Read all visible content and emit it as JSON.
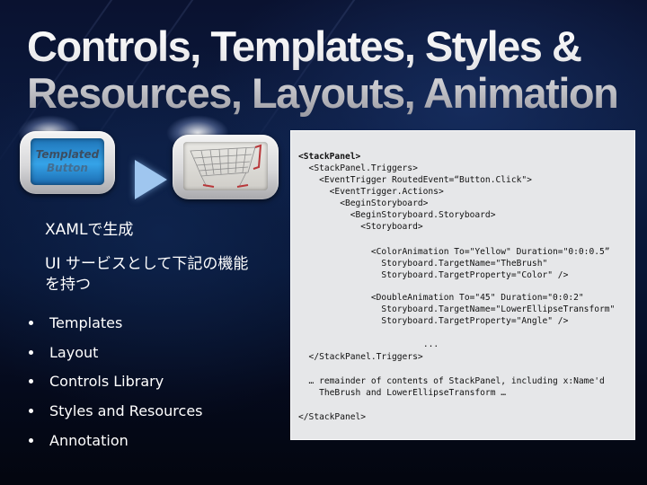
{
  "slide": {
    "title_lines": [
      "Controls, Templates, Styles &",
      "Resources, Layouts, Animation"
    ],
    "templated_button": {
      "line1": "Templated",
      "line2": "Button"
    },
    "cart_button_icon": "shopping-cart-icon",
    "arrow_icon": "play-triangle-icon",
    "xaml_label": "XAMLで生成",
    "ui_services_text_line1": "UI サービスとして下記の機能",
    "ui_services_text_line2": "を持つ",
    "bullets": [
      "Templates",
      "Layout",
      "Controls Library",
      "Styles and Resources",
      "Annotation"
    ],
    "code_lines": [
      "<StackPanel>",
      "  <StackPanel.Triggers>",
      "    <EventTrigger RoutedEvent=“Button.Click\">",
      "      <EventTrigger.Actions>",
      "        <BeginStoryboard>",
      "          <BeginStoryboard.Storyboard>",
      "            <Storyboard>",
      "              <ColorAnimation To=\"Yellow\" Duration=\"0:0:0.5”",
      "                Storyboard.TargetName=\"TheBrush\"",
      "                Storyboard.TargetProperty=\"Color\" />",
      "              <DoubleAnimation To=\"45\" Duration=\"0:0:2\"",
      "                Storyboard.TargetName=\"LowerEllipseTransform\"",
      "                Storyboard.TargetProperty=\"Angle\" />",
      "              ...",
      "  </StackPanel.Triggers>",
      "  … remainder of contents of StackPanel, including x:Name'd",
      "    TheBrush and LowerEllipseTransform …",
      "</StackPanel>"
    ]
  }
}
